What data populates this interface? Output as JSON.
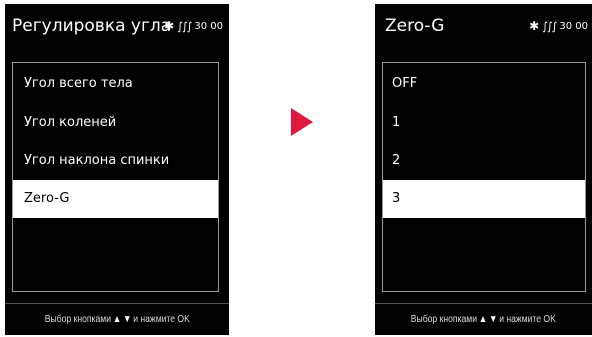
{
  "left_screen": {
    "title": "Регулировка угла",
    "status_icons": [
      "bluetooth-icon",
      "heat-wave-icon"
    ],
    "status_numbers": "30 00",
    "menu_items": [
      {
        "label": "Угол всего тела",
        "selected": false
      },
      {
        "label": "Угол коленей",
        "selected": false
      },
      {
        "label": "Угол наклона спинки",
        "selected": false
      },
      {
        "label": "Zero-G",
        "selected": true
      }
    ],
    "footer": {
      "hint_prefix": "Выбор кнопками",
      "hint_suffix": "и нажмите OK",
      "up_symbol": "▲",
      "down_symbol": "▼"
    }
  },
  "right_screen": {
    "title": "Zero-G",
    "status_icons": [
      "bluetooth-icon",
      "heat-wave-icon"
    ],
    "status_numbers": "30 00",
    "menu_items": [
      {
        "label": "OFF",
        "selected": false
      },
      {
        "label": "1",
        "selected": false
      },
      {
        "label": "2",
        "selected": false
      },
      {
        "label": "3",
        "selected": true
      }
    ],
    "footer": {
      "hint_prefix": "Выбор кнопками",
      "hint_suffix": "и нажмите OK",
      "up_symbol": "▲",
      "down_symbol": "▼"
    }
  },
  "transition_arrow": {
    "icon": "play-arrow-icon",
    "color": "#e01840"
  },
  "colors": {
    "screen_background": "#000000",
    "text": "#ffffff",
    "selected_background": "#ffffff",
    "selected_text": "#000000"
  }
}
